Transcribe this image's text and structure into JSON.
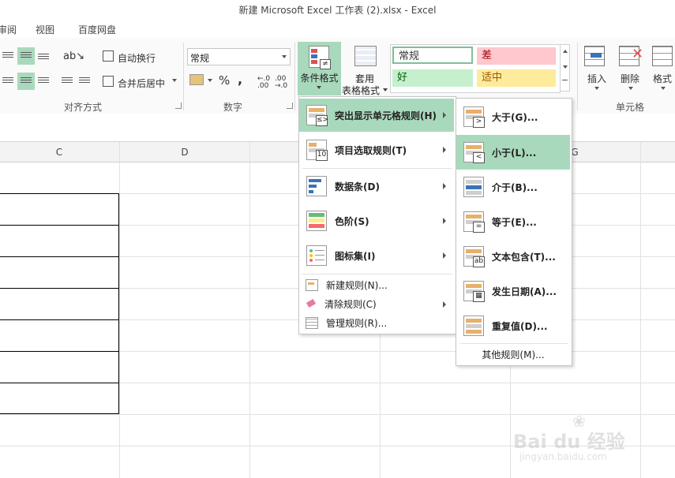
{
  "window": {
    "title": "新建 Microsoft Excel 工作表 (2).xlsx - Excel"
  },
  "tabs": [
    "审阅",
    "视图",
    "百度网盘"
  ],
  "ribbon": {
    "alignment": {
      "wrap_text": "自动换行",
      "merge_center": "合并后居中",
      "group_label": "对齐方式"
    },
    "number": {
      "format_value": "常规",
      "percent": "%",
      "comma": ",",
      "inc_decimal": "←.0 .00",
      "dec_decimal": ".00 →.0",
      "group_label": "数字"
    },
    "styles": {
      "conditional_format": "条件格式",
      "table_format_line1": "套用",
      "table_format_line2": "表格格式",
      "cells": [
        {
          "label": "常规",
          "bg": "#ffffff",
          "color": "#222222"
        },
        {
          "label": "差",
          "bg": "#ffc7ce",
          "color": "#9c0006"
        },
        {
          "label": "好",
          "bg": "#c6efce",
          "color": "#006100"
        },
        {
          "label": "适中",
          "bg": "#ffeb9c",
          "color": "#9c5700"
        }
      ]
    },
    "cells_group": {
      "insert": "插入",
      "delete": "删除",
      "format": "格式",
      "group_label": "单元格"
    }
  },
  "grid": {
    "columns": [
      "C",
      "D",
      "G"
    ]
  },
  "cf_menu": {
    "items": [
      {
        "label": "突出显示单元格规则(H)",
        "icon": "highlight-rules-icon",
        "submenu": true
      },
      {
        "label": "项目选取规则(T)",
        "icon": "top-bottom-rules-icon",
        "submenu": true
      },
      {
        "label": "数据条(D)",
        "icon": "data-bars-icon",
        "submenu": true
      },
      {
        "label": "色阶(S)",
        "icon": "color-scales-icon",
        "submenu": true
      },
      {
        "label": "图标集(I)",
        "icon": "icon-sets-icon",
        "submenu": true
      }
    ],
    "small_items": [
      {
        "label": "新建规则(N)...",
        "icon": "new-rule-icon"
      },
      {
        "label": "清除规则(C)",
        "icon": "clear-rules-icon",
        "submenu": true
      },
      {
        "label": "管理规则(R)...",
        "icon": "manage-rules-icon"
      }
    ]
  },
  "highlight_submenu": {
    "items": [
      {
        "label": "大于(G)...",
        "symbol": ">"
      },
      {
        "label": "小于(L)...",
        "symbol": "<"
      },
      {
        "label": "介于(B)...",
        "symbol": ""
      },
      {
        "label": "等于(E)...",
        "symbol": "="
      },
      {
        "label": "文本包含(T)...",
        "symbol": "ab"
      },
      {
        "label": "发生日期(A)...",
        "symbol": "▦"
      },
      {
        "label": "重复值(D)...",
        "symbol": ""
      }
    ],
    "more": "其他规则(M)..."
  },
  "watermark": {
    "logo": "Bai du 经验",
    "url": "jingyan.baidu.com"
  },
  "colors": {
    "accent_green": "#217346",
    "menu_highlight": "#a9d9bc"
  }
}
